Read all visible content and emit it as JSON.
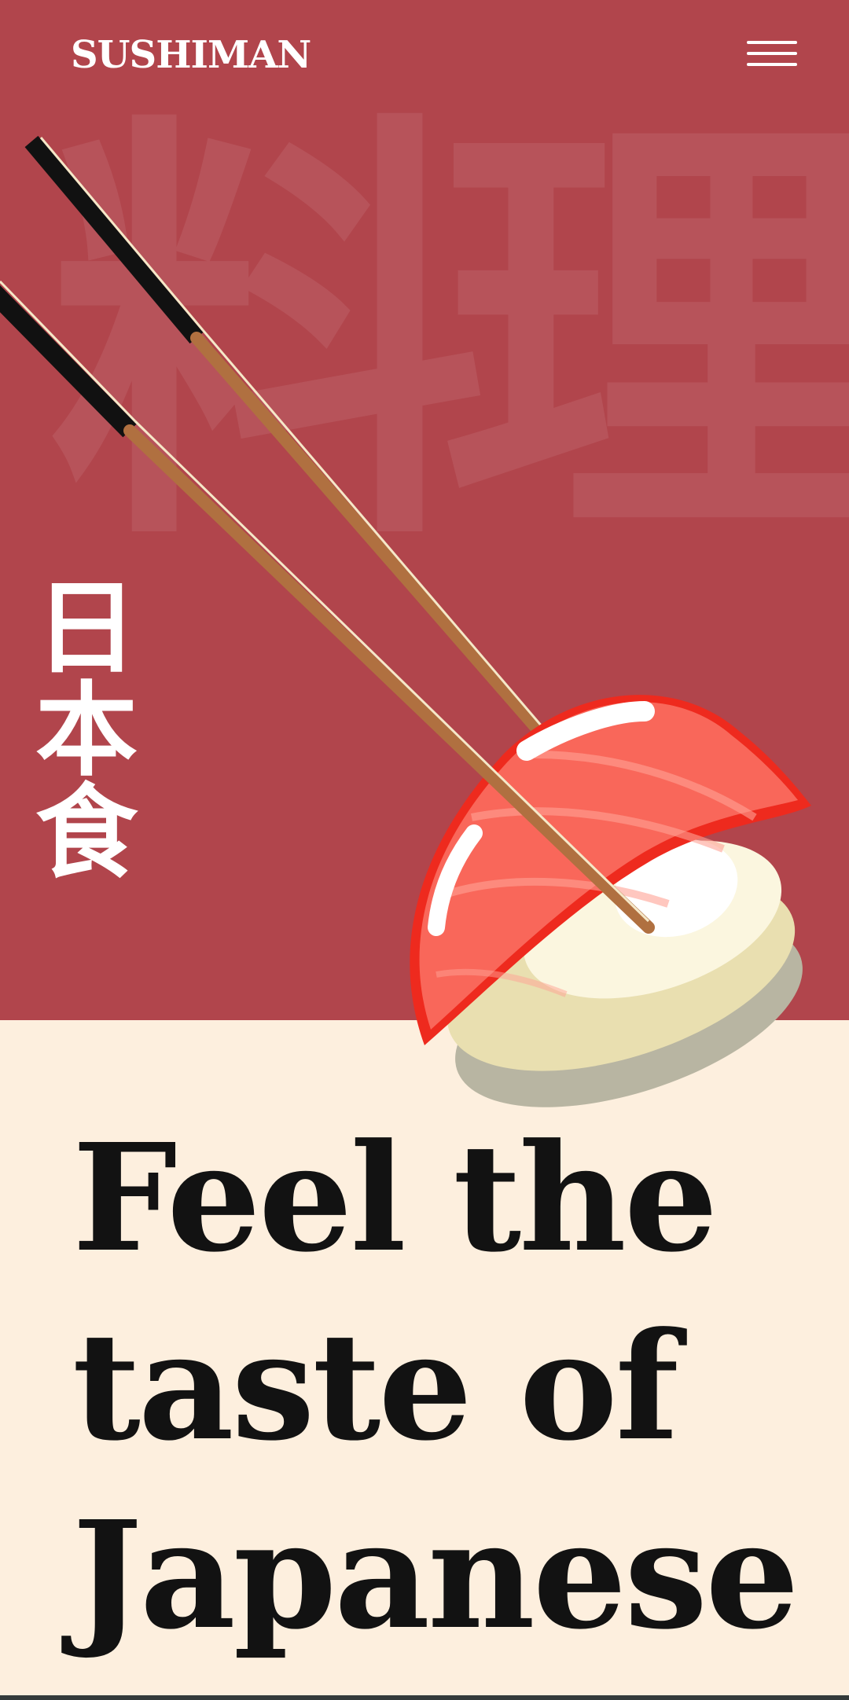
{
  "header": {
    "logo": "SUSHIMAN",
    "menu_icon": "hamburger-menu-icon"
  },
  "hero": {
    "background_kanji": "料理",
    "vertical_kanji": "日本食",
    "illustration_icon": "nigiri-sushi-with-chopsticks-icon"
  },
  "headline": "Feel the taste of Japanese",
  "colors": {
    "hero_background": "#b1454c",
    "page_background": "#fdefde",
    "headline_text": "#121212",
    "logo_text": "#ffffff"
  }
}
